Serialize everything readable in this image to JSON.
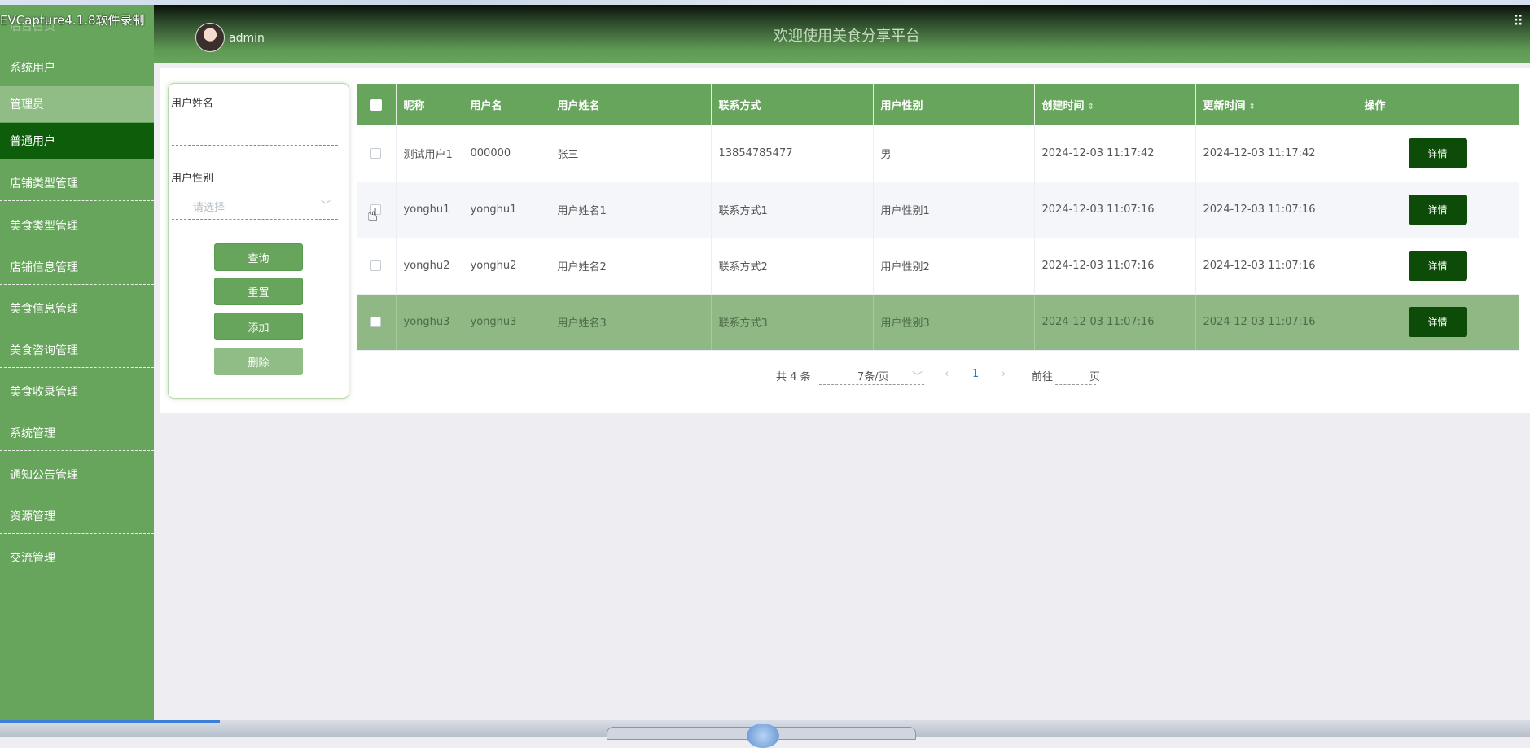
{
  "overlay": {
    "recorder_label": "EVCapture4.1.8软件录制"
  },
  "header": {
    "username": "admin",
    "welcome": "欢迎使用美食分享平台"
  },
  "sidebar": {
    "ghost_label": "后台首页",
    "items": [
      {
        "label": "系统用户"
      },
      {
        "label": "管理员"
      },
      {
        "label": "普通用户"
      },
      {
        "label": "店铺类型管理"
      },
      {
        "label": "美食类型管理"
      },
      {
        "label": "店铺信息管理"
      },
      {
        "label": "美食信息管理"
      },
      {
        "label": "美食咨询管理"
      },
      {
        "label": "美食收录管理"
      },
      {
        "label": "系统管理"
      },
      {
        "label": "通知公告管理"
      },
      {
        "label": "资源管理"
      },
      {
        "label": "交流管理"
      }
    ]
  },
  "filter": {
    "name_label": "用户姓名",
    "name_value": "",
    "gender_label": "用户性别",
    "gender_placeholder": "请选择",
    "buttons": {
      "query": "查询",
      "reset": "重置",
      "add": "添加",
      "delete": "删除"
    }
  },
  "table": {
    "columns": [
      "昵称",
      "用户名",
      "用户姓名",
      "联系方式",
      "用户性别",
      "创建时间",
      "更新时间",
      "操作"
    ],
    "rows": [
      {
        "nickname": "测试用户1",
        "username": "000000",
        "real_name": "张三",
        "contact": "13854785477",
        "gender": "男",
        "created": "2024-12-03 11:17:42",
        "updated": "2024-12-03 11:17:42",
        "action": "详情"
      },
      {
        "nickname": "yonghu1",
        "username": "yonghu1",
        "real_name": "用户姓名1",
        "contact": "联系方式1",
        "gender": "用户性别1",
        "created": "2024-12-03 11:07:16",
        "updated": "2024-12-03 11:07:16",
        "action": "详情"
      },
      {
        "nickname": "yonghu2",
        "username": "yonghu2",
        "real_name": "用户姓名2",
        "contact": "联系方式2",
        "gender": "用户性别2",
        "created": "2024-12-03 11:07:16",
        "updated": "2024-12-03 11:07:16",
        "action": "详情"
      },
      {
        "nickname": "yonghu3",
        "username": "yonghu3",
        "real_name": "用户姓名3",
        "contact": "联系方式3",
        "gender": "用户性别3",
        "created": "2024-12-03 11:07:16",
        "updated": "2024-12-03 11:07:16",
        "action": "详情"
      }
    ]
  },
  "pagination": {
    "total": "共 4 条",
    "page_size": "7条/页",
    "current_page": "1",
    "goto_label": "前往",
    "page_unit": "页"
  },
  "colors": {
    "primary_green": "#67a45c",
    "active_dark_green": "#0d5d0a",
    "detail_button": "#0d4c08"
  }
}
